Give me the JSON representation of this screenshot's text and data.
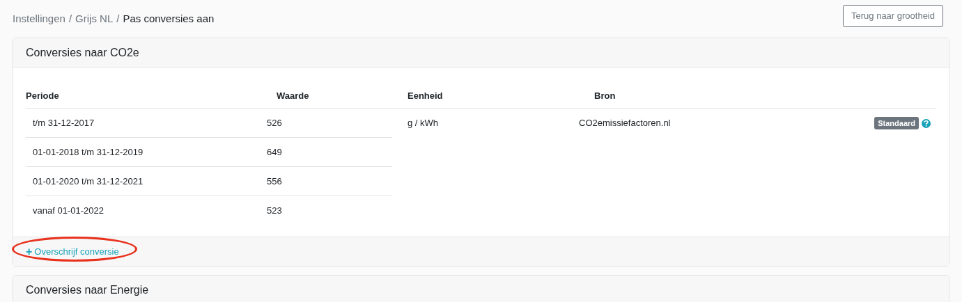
{
  "breadcrumb": [
    {
      "label": "Instellingen",
      "current": false
    },
    {
      "label": "Grijs NL",
      "current": false
    },
    {
      "label": "Pas conversies aan",
      "current": true
    }
  ],
  "separator": "/",
  "back_button": "Terug naar grootheid",
  "cards": [
    {
      "title": "Conversies naar CO2e",
      "columns": [
        "Periode",
        "Waarde",
        "Eenheid",
        "Bron"
      ],
      "periods": [
        {
          "period": "t/m 31-12-2017",
          "value": "526"
        },
        {
          "period": "01-01-2018 t/m 31-12-2019",
          "value": "649"
        },
        {
          "period": "01-01-2020 t/m 31-12-2021",
          "value": "556"
        },
        {
          "period": "vanaf 01-01-2022",
          "value": "523"
        }
      ],
      "unit": "g / kWh",
      "source": "CO2emissiefactoren.nl",
      "badge": "Standaard",
      "footer_link": {
        "icon": "+",
        "label": "Overschrijf conversie",
        "annotated": true
      }
    },
    {
      "title": "Conversies naar Energie"
    }
  ]
}
